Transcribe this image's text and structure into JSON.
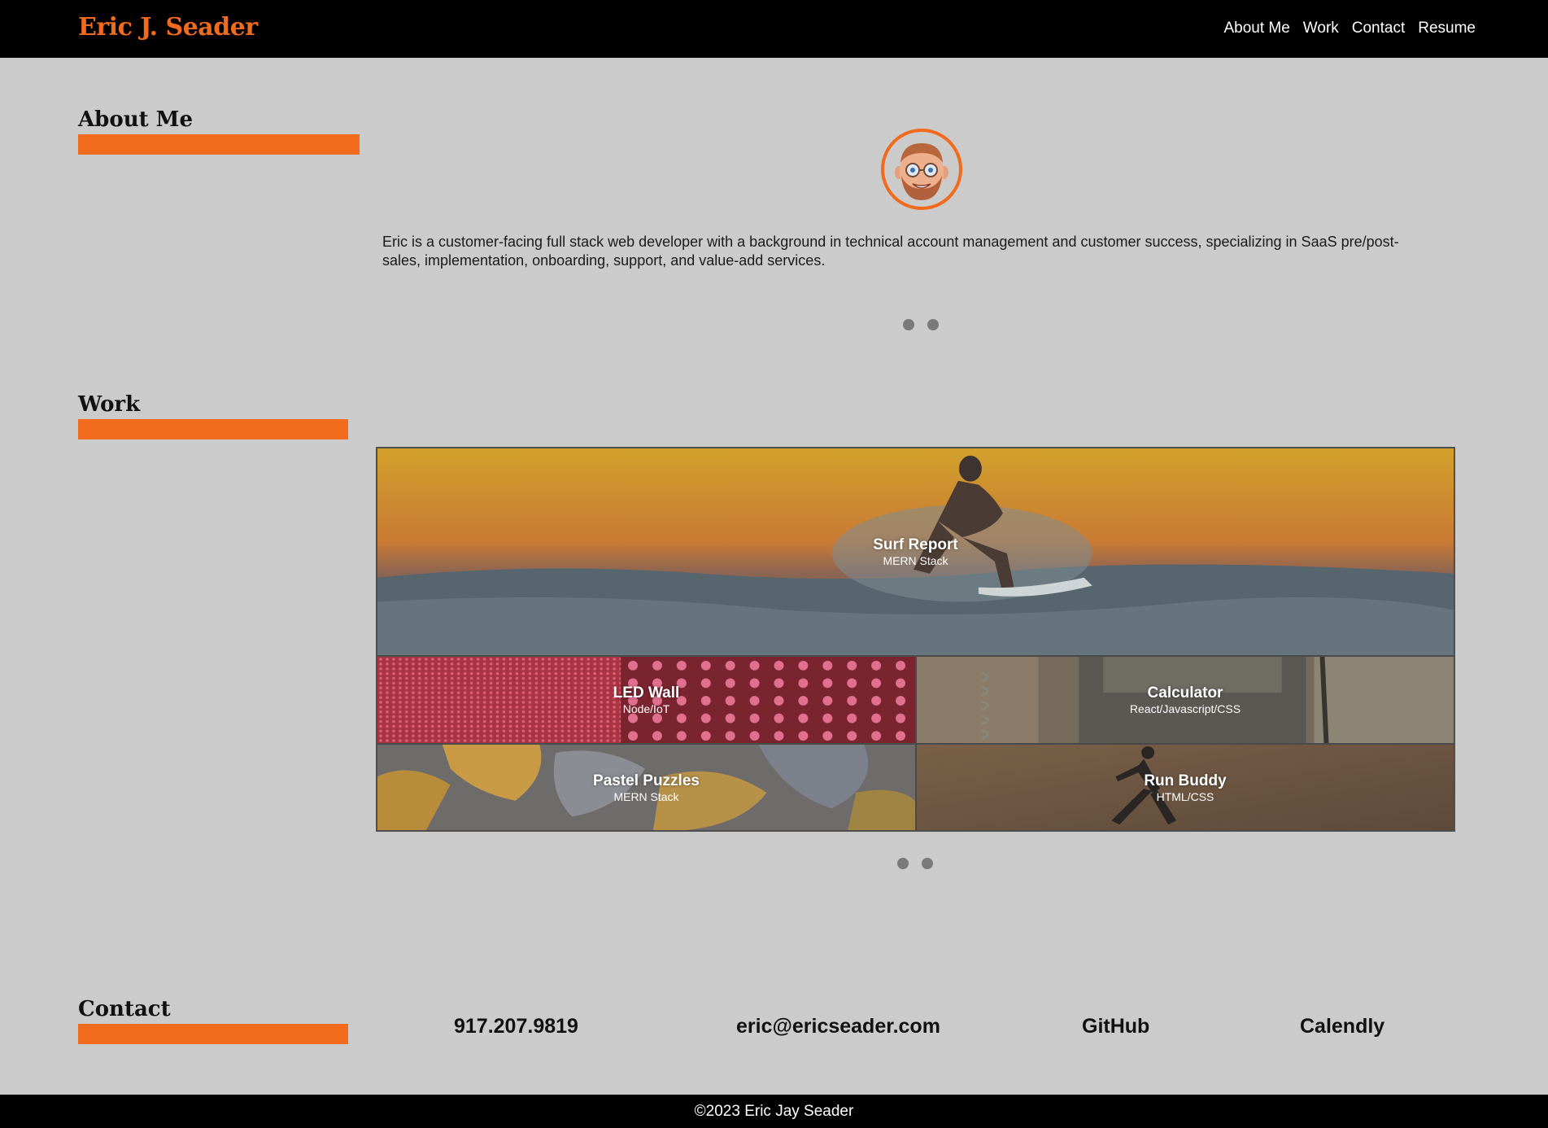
{
  "header": {
    "brand": "Eric J. Seader",
    "nav": [
      "About Me",
      "Work",
      "Contact",
      "Resume"
    ]
  },
  "about": {
    "title": "About Me",
    "text": "Eric is a customer-facing full stack web developer with a background in technical account management and customer success, specializing in SaaS pre/post-sales, implementation, onboarding, support, and value-add services.",
    "avatar_icon": "memoji-avatar-icon",
    "carousel_pages": 2
  },
  "work": {
    "title": "Work",
    "projects": [
      {
        "title": "Surf Report",
        "subtitle": "MERN Stack",
        "image": "surfer-photo"
      },
      {
        "title": "LED Wall",
        "subtitle": "Node/IoT",
        "image": "led-wall-photo"
      },
      {
        "title": "Calculator",
        "subtitle": "React/Javascript/CSS",
        "image": "calculator-photo"
      },
      {
        "title": "Pastel Puzzles",
        "subtitle": "MERN Stack",
        "image": "puzzle-photo"
      },
      {
        "title": "Run Buddy",
        "subtitle": "HTML/CSS",
        "image": "runner-photo"
      }
    ],
    "carousel_pages": 2
  },
  "contact": {
    "title": "Contact",
    "phone": "917.207.9819",
    "email": "eric@ericseader.com",
    "github": "GitHub",
    "calendly": "Calendly"
  },
  "footer": {
    "copyright": "©2023 Eric Jay Seader"
  },
  "colors": {
    "accent": "#f26a1b",
    "background": "#cbcbcb",
    "header": "#000000"
  }
}
